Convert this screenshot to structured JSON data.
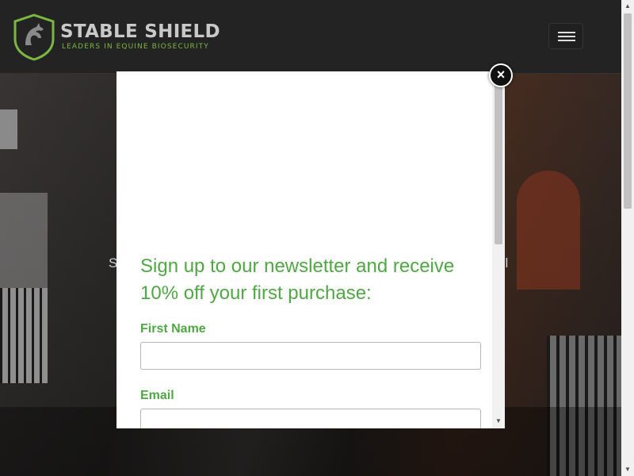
{
  "header": {
    "brand_name": "STABLE SHIELD",
    "brand_tagline": "LEADERS IN EQUINE BIOSECURITY",
    "logo_icon": "horse-shield-icon",
    "menu_icon": "hamburger-menu-icon"
  },
  "hero": {
    "text_left": "S",
    "text_right": "ul"
  },
  "modal": {
    "heading": "Sign up to our newsletter and receive 10% off your first purchase:",
    "first_name_label": "First Name",
    "first_name_value": "",
    "email_label": "Email",
    "email_value": "",
    "close_symbol": "×",
    "close_icon": "close-icon"
  },
  "colors": {
    "accent_green": "#4fa843",
    "logo_green": "#7bb742",
    "header_bg": "#232323"
  }
}
